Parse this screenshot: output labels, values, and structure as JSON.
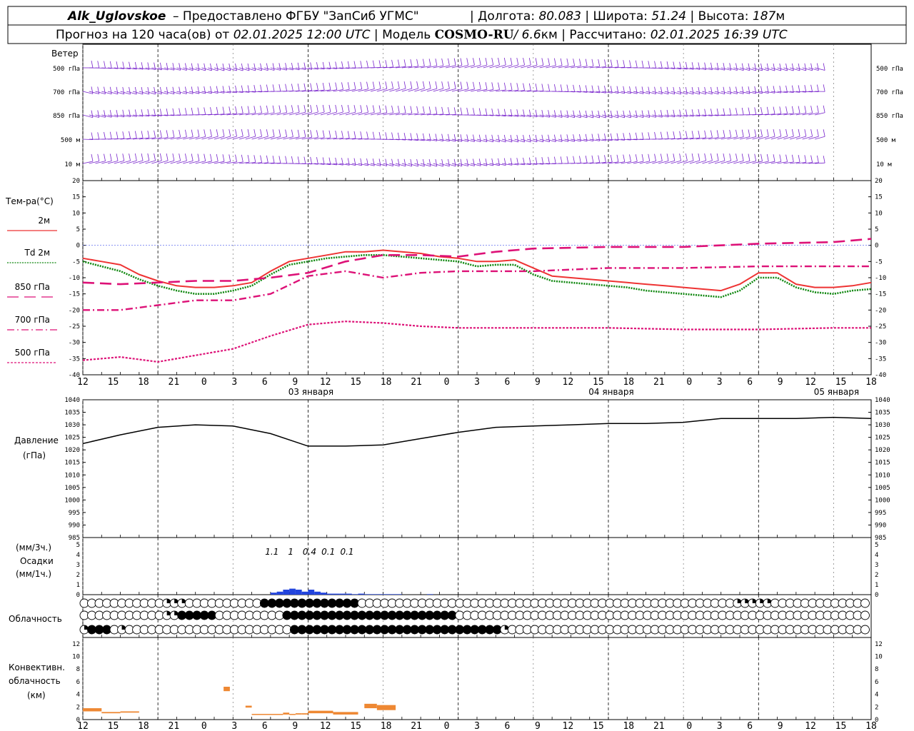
{
  "header": {
    "station": "Alk_Uglovskoe",
    "sep1": " – ",
    "provider": "Предоставлено ФГБУ \"ЗапСиб УГМС\"",
    "lon_label": "Долгота:",
    "lon": "80.083",
    "lat_label": "Широта:",
    "lat": "51.24",
    "alt_label": "Высота:",
    "alt": "187",
    "alt_unit": "м",
    "forecast_prefix": "Прогноз на 120 часа(ов) от",
    "forecast_time": "02.01.2025 12:00 UTC",
    "model_label": "Модель",
    "model": "COSMO-RU",
    "model_res": "/ 6.6",
    "model_res_unit": "км",
    "calc_label": "Рассчитано:",
    "calc_time": "02.01.2025 16:39 UTC"
  },
  "wind_panel": {
    "title": "Ветер",
    "levels": [
      "500 гПа",
      "700 гПа",
      "850 гПа",
      "500 м",
      "10  м"
    ]
  },
  "temp_panel": {
    "title": "Тем-ра(°C)",
    "legend": [
      {
        "label": "2м",
        "color": "#ee3333"
      },
      {
        "label": "Td  2м",
        "color": "#118811"
      },
      {
        "label": "850 гПа",
        "color": "#dd1177"
      },
      {
        "label": "700 гПа",
        "color": "#dd1177"
      },
      {
        "label": "500 гПа",
        "color": "#dd1177"
      }
    ]
  },
  "pressure_panel": {
    "title": "Давление",
    "unit": "(гПа)"
  },
  "precip_panel": {
    "unit_3h": "(мм/3ч.)",
    "title": "Осадки",
    "unit_1h": "(мм/1ч.)"
  },
  "cloud_panel": {
    "title": "Облачность"
  },
  "conv_panel": {
    "title_1": "Конвективн.",
    "title_2": "облачность",
    "unit": "(км)"
  },
  "x_axis": {
    "hour_labels": [
      "12",
      "15",
      "18",
      "21",
      "0",
      "3",
      "6",
      "9",
      "12",
      "15",
      "18",
      "21",
      "0",
      "3",
      "6",
      "9",
      "12",
      "15",
      "18",
      "21",
      "0",
      "3",
      "6",
      "9",
      "12",
      "15",
      "18"
    ],
    "day_labels": [
      "03 января",
      "04 января",
      "05 января"
    ]
  },
  "chart_data": {
    "type": "line",
    "x_hours_since_start": "0..126 step 3 (12 UTC 02.01 to 18 UTC 05.01)",
    "temperature": {
      "ylim": [
        -40,
        20
      ],
      "yticks": [
        20,
        15,
        10,
        5,
        0,
        -5,
        -10,
        -15,
        -20,
        -25,
        -30,
        -35,
        -40
      ],
      "series": [
        {
          "name": "2м",
          "color": "#ee3333",
          "style": "solid",
          "x": [
            0,
            3,
            6,
            9,
            12,
            15,
            18,
            21,
            24,
            27,
            30,
            33,
            36,
            39,
            42,
            45,
            48,
            51,
            54,
            57,
            60,
            63,
            66,
            69,
            72,
            75,
            78,
            81,
            84,
            87,
            90,
            93,
            96,
            99,
            102,
            105,
            108,
            111,
            114,
            117,
            120,
            123,
            126
          ],
          "y": [
            -4,
            -5,
            -6,
            -9,
            -11,
            -12.5,
            -13,
            -13,
            -12.5,
            -11.5,
            -8,
            -5,
            -4,
            -3,
            -2,
            -2,
            -1.5,
            -2,
            -2.5,
            -3.5,
            -4,
            -5,
            -5,
            -4.5,
            -7,
            -9.5,
            -10,
            -10.5,
            -11,
            -11.5,
            -12,
            -12.5,
            -13,
            -13.5,
            -14,
            -12,
            -8.5,
            -8.5,
            -12,
            -13,
            -13,
            -12.5,
            -11.5
          ]
        },
        {
          "name": "Td  2м",
          "color": "#118811",
          "style": "dotted",
          "x": [
            0,
            3,
            6,
            9,
            12,
            15,
            18,
            21,
            24,
            27,
            30,
            33,
            36,
            39,
            42,
            45,
            48,
            51,
            54,
            57,
            60,
            63,
            66,
            69,
            72,
            75,
            78,
            81,
            84,
            87,
            90,
            93,
            96,
            99,
            102,
            105,
            108,
            111,
            114,
            117,
            120,
            123,
            126
          ],
          "y": [
            -5,
            -6.5,
            -8,
            -10.5,
            -12.5,
            -14,
            -15,
            -15,
            -14,
            -12.5,
            -9,
            -6,
            -5,
            -4,
            -3.5,
            -3,
            -3,
            -3.5,
            -4,
            -4.5,
            -5,
            -6.5,
            -6,
            -6,
            -9,
            -11,
            -11.5,
            -12,
            -12.5,
            -13,
            -14,
            -14.5,
            -15,
            -15.5,
            -16,
            -14,
            -10,
            -10,
            -13,
            -14.5,
            -15,
            -14,
            -13.5
          ]
        },
        {
          "name": "850 гПа",
          "color": "#dd1177",
          "style": "long-dash",
          "x": [
            0,
            6,
            12,
            18,
            24,
            30,
            36,
            42,
            48,
            54,
            60,
            66,
            72,
            84,
            96,
            108,
            120,
            126
          ],
          "y": [
            -11.5,
            -12,
            -11.5,
            -11,
            -11,
            -10,
            -8.5,
            -5,
            -3,
            -3,
            -3.5,
            -2,
            -1,
            -0.5,
            -0.5,
            0.5,
            1,
            2
          ]
        },
        {
          "name": "700 гПа",
          "color": "#dd1177",
          "style": "dash-dot",
          "x": [
            0,
            6,
            12,
            18,
            24,
            30,
            36,
            42,
            48,
            54,
            60,
            66,
            72,
            84,
            96,
            108,
            120,
            126
          ],
          "y": [
            -20,
            -20,
            -18.5,
            -17,
            -17,
            -15,
            -9.5,
            -8,
            -10,
            -8.5,
            -8,
            -8,
            -8,
            -7,
            -7,
            -6.5,
            -6.5,
            -6.5
          ]
        },
        {
          "name": "500 гПа",
          "color": "#dd1177",
          "style": "short-dash",
          "x": [
            0,
            6,
            12,
            18,
            24,
            30,
            36,
            42,
            48,
            54,
            60,
            66,
            72,
            84,
            96,
            108,
            120,
            126
          ],
          "y": [
            -35.5,
            -34.5,
            -36,
            -34,
            -32,
            -28,
            -24.5,
            -23.5,
            -24,
            -25,
            -25.5,
            -25.5,
            -25.5,
            -25.5,
            -26,
            -26,
            -25.5,
            -25.5
          ]
        }
      ]
    },
    "pressure": {
      "ylim": [
        985,
        1040
      ],
      "yticks": [
        1040,
        1035,
        1030,
        1025,
        1020,
        1015,
        1010,
        1005,
        1000,
        995,
        990,
        985
      ],
      "color": "#000000",
      "x": [
        0,
        6,
        12,
        18,
        24,
        30,
        36,
        42,
        48,
        54,
        60,
        66,
        72,
        78,
        84,
        90,
        96,
        102,
        108,
        114,
        120,
        126
      ],
      "y": [
        1022.5,
        1026,
        1029,
        1030,
        1029.5,
        1026.5,
        1021.5,
        1021.5,
        1022,
        1024.5,
        1027,
        1029,
        1029.5,
        1030,
        1030.5,
        1030.5,
        1031,
        1032.5,
        1032.5,
        1032.5,
        1033,
        1032.5
      ]
    },
    "precip": {
      "ylim": [
        0,
        5
      ],
      "yticks": [
        5,
        4,
        3,
        2,
        1,
        0
      ],
      "color": "#2244dd",
      "x": [
        30,
        31,
        32,
        33,
        34,
        35,
        36,
        37,
        38,
        39,
        40,
        41,
        42,
        43,
        44,
        45,
        46,
        47,
        48,
        49,
        50,
        51,
        52,
        53,
        54,
        55,
        56,
        57,
        58,
        59,
        60
      ],
      "y": [
        0.2,
        0.3,
        0.5,
        0.6,
        0.5,
        0.3,
        0.5,
        0.3,
        0.2,
        0.1,
        0.1,
        0.1,
        0.1,
        0.05,
        0.1,
        0.05,
        0.05,
        0.05,
        0.05,
        0.05,
        0.05,
        0,
        0,
        0,
        0,
        0.05,
        0,
        0,
        0,
        0,
        0
      ],
      "totals_3h": [
        {
          "x": 30,
          "label": "1.1"
        },
        {
          "x": 33,
          "label": "1"
        },
        {
          "x": 36,
          "label": "0.4"
        },
        {
          "x": 39,
          "label": "0.1"
        },
        {
          "x": 42,
          "label": "0.1"
        }
      ]
    },
    "clouds": {
      "note": "cover in octas per row: high, middle, low (one symbol per hour)",
      "high": [
        0,
        0,
        0,
        0,
        0,
        0,
        0,
        0,
        0,
        0,
        0,
        0,
        0,
        0,
        0,
        0,
        0,
        0,
        0,
        0,
        0,
        0,
        0,
        0,
        0,
        0,
        0,
        0,
        0,
        0,
        0,
        0,
        0,
        0,
        0,
        0,
        0,
        0,
        0,
        0,
        0,
        0,
        0,
        0,
        0,
        0,
        0,
        0,
        0,
        0,
        0,
        0,
        0,
        0,
        0,
        0,
        0,
        0,
        0,
        0,
        0,
        0,
        0,
        0,
        0,
        0,
        0,
        0,
        0,
        0,
        0,
        0,
        0,
        0,
        0,
        0,
        0,
        0,
        0,
        0,
        0,
        0,
        0,
        0,
        0,
        0,
        0,
        0,
        0,
        0,
        0,
        0,
        0,
        0,
        0,
        0,
        0,
        0,
        0,
        0,
        0,
        0,
        0,
        0,
        0,
        0,
        0,
        0,
        0,
        0,
        0,
        0,
        0,
        0,
        0,
        0,
        0,
        0,
        0,
        0,
        0,
        0,
        0,
        0,
        0,
        0,
        0
      ],
      "middle": [
        0,
        0,
        0,
        0,
        0,
        0,
        0,
        0,
        0,
        0,
        0,
        0,
        0,
        0,
        0,
        0,
        0,
        0,
        0,
        0,
        0,
        0,
        0,
        0,
        0,
        0,
        0,
        0,
        0,
        0,
        0,
        0,
        0,
        0,
        0,
        0,
        0,
        0,
        0,
        0,
        0,
        0,
        0,
        0,
        0,
        0,
        0,
        0,
        0,
        0,
        0,
        0,
        0,
        0,
        0,
        0,
        0,
        0,
        0,
        0,
        0,
        0,
        0,
        0,
        0,
        0,
        0,
        0,
        0,
        0,
        0,
        0,
        0,
        0,
        0,
        0,
        0,
        0,
        0,
        0,
        0,
        0,
        0,
        0,
        0,
        0,
        0,
        0,
        0,
        0,
        0,
        0,
        0,
        0,
        0,
        0,
        0,
        0,
        0,
        0,
        0,
        0,
        0,
        0,
        0,
        0,
        0,
        0,
        0,
        0,
        0,
        0,
        0,
        0,
        0,
        0,
        0,
        0,
        0,
        0,
        0,
        0,
        0,
        0,
        0,
        0,
        0
      ],
      "low": [
        0,
        0,
        0,
        0,
        0,
        0,
        0,
        0,
        0,
        0,
        0,
        0,
        0,
        0,
        0,
        0,
        0,
        0,
        0,
        0,
        0,
        0,
        0,
        0,
        0,
        0,
        0,
        0,
        0,
        0,
        0,
        0,
        0,
        0,
        0,
        0,
        0,
        0,
        0,
        0,
        0,
        0,
        0,
        0,
        0,
        0,
        0,
        0,
        0,
        0,
        0,
        0,
        0,
        0,
        0,
        0,
        0,
        0,
        0,
        0,
        0,
        0,
        0,
        0,
        0,
        0,
        0,
        0,
        0,
        0,
        0,
        0,
        0,
        0,
        0,
        0,
        0,
        0,
        0,
        0,
        0,
        0,
        0,
        0,
        0,
        0,
        0,
        0,
        0,
        0,
        0,
        0,
        0,
        0,
        0,
        0,
        0,
        0,
        0,
        0,
        0,
        0,
        0,
        0,
        0,
        0,
        0,
        0,
        0,
        0,
        0,
        0,
        0,
        0,
        0,
        0,
        0,
        0,
        0,
        0,
        0,
        0,
        0,
        0,
        0,
        0,
        0
      ]
    },
    "convective": {
      "ylim": [
        0,
        13
      ],
      "yticks": [
        12,
        10,
        8,
        6,
        4,
        2,
        0
      ],
      "color": "#ee8833",
      "segments": [
        {
          "x0": 0,
          "x1": 3,
          "bottom": 1.3,
          "top": 1.8
        },
        {
          "x0": 3,
          "x1": 6,
          "bottom": 1.0,
          "top": 1.2
        },
        {
          "x0": 6,
          "x1": 9,
          "bottom": 1.1,
          "top": 1.3
        },
        {
          "x0": 22.5,
          "x1": 23.5,
          "bottom": 4.5,
          "top": 5.2
        },
        {
          "x0": 26,
          "x1": 27,
          "bottom": 1.9,
          "top": 2.2
        },
        {
          "x0": 27,
          "x1": 32,
          "bottom": 0.8,
          "top": 0.9
        },
        {
          "x0": 32,
          "x1": 33,
          "bottom": 0.8,
          "top": 1.1
        },
        {
          "x0": 33,
          "x1": 34,
          "bottom": 0.8,
          "top": 0.9
        },
        {
          "x0": 34,
          "x1": 35,
          "bottom": 0.8,
          "top": 1.0
        },
        {
          "x0": 35,
          "x1": 36,
          "bottom": 0.8,
          "top": 1.0
        },
        {
          "x0": 36,
          "x1": 40,
          "bottom": 1.0,
          "top": 1.4
        },
        {
          "x0": 40,
          "x1": 44,
          "bottom": 0.8,
          "top": 1.2
        },
        {
          "x0": 45,
          "x1": 47,
          "bottom": 1.8,
          "top": 2.5
        },
        {
          "x0": 47,
          "x1": 50,
          "bottom": 1.5,
          "top": 2.3
        }
      ]
    },
    "wind": {
      "color": "#7722cc",
      "note": "wind barbs at 5 levels along the forecast period"
    }
  }
}
